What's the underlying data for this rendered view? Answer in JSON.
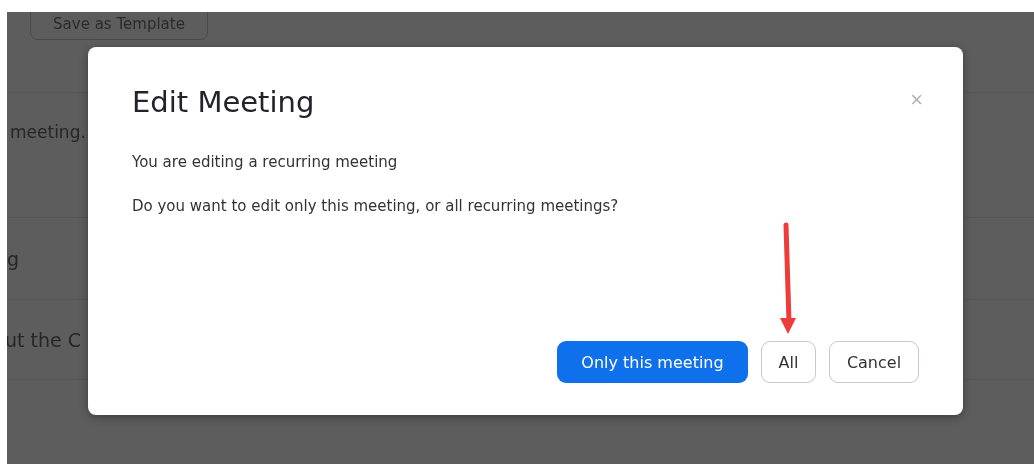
{
  "background": {
    "template_button": "Save as Template",
    "rows": [
      {
        "text": "meeting."
      },
      {
        "text": "g"
      },
      {
        "text": "ut the C"
      }
    ]
  },
  "dialog": {
    "title": "Edit Meeting",
    "close": "×",
    "messages": [
      "You are editing a recurring meeting",
      "Do you want to edit only this meeting, or all recurring meetings?"
    ],
    "buttons": [
      {
        "label": "Only this meeting",
        "kind": "primary"
      },
      {
        "label": "All",
        "kind": "secondary"
      },
      {
        "label": "Cancel",
        "kind": "secondary"
      }
    ]
  }
}
